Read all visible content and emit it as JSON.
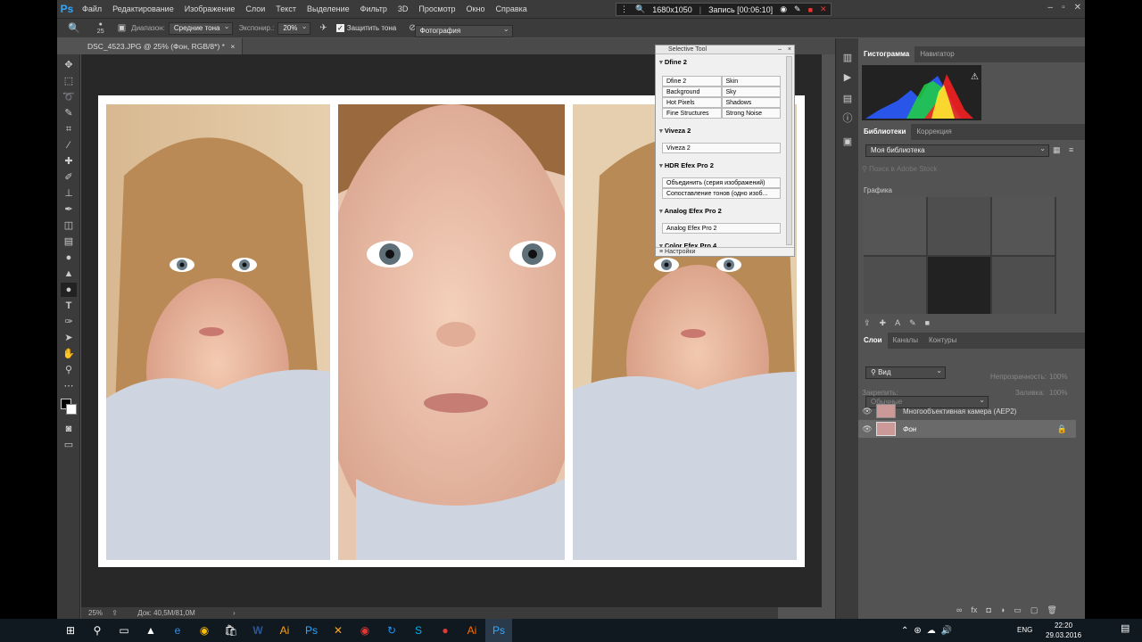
{
  "menubar": {
    "logo": "Ps",
    "items": [
      "Файл",
      "Редактирование",
      "Изображение",
      "Слои",
      "Текст",
      "Выделение",
      "Фильтр",
      "3D",
      "Просмотр",
      "Окно",
      "Справка"
    ],
    "rec_resolution": "1680x1050",
    "rec_label": "Запись [00:06:10]"
  },
  "options": {
    "brush_size": "25",
    "range_label": "Диапазон:",
    "range_value": "Средние тона",
    "exposure_label": "Экспонир.:",
    "exposure_value": "20%",
    "protect_label": "Защитить тона",
    "workspace": "Фотография"
  },
  "document": {
    "tab_title": "DSC_4523.JPG @ 25% (Фон, RGB/8*) *",
    "zoom": "25%",
    "doc_size": "Док: 40,5M/81,0M"
  },
  "selective_tool": {
    "title": "Selective Tool",
    "dfine_title": "Dfine 2",
    "dfine_items": [
      [
        "Dfine 2",
        "Skin"
      ],
      [
        "Background",
        "Sky"
      ],
      [
        "Hot Pixels",
        "Shadows"
      ],
      [
        "Fine Structures",
        "Strong Noise"
      ]
    ],
    "viveza_title": "Viveza 2",
    "viveza_item": "Viveza 2",
    "hdr_title": "HDR Efex Pro 2",
    "hdr_items": [
      "Объединить (серия изображений)",
      "Сопоставление тонов (одно изоб..."
    ],
    "analog_title": "Analog Efex Pro 2",
    "analog_item": "Analog Efex Pro 2",
    "color_title": "Color Efex Pro 4",
    "settings": "Настройки"
  },
  "panels": {
    "histogram_tab": "Гистограмма",
    "navigator_tab": "Навигатор",
    "libraries_tab": "Библиотеки",
    "adjust_tab": "Коррекция",
    "library_name": "Моя библиотека",
    "search_placeholder": "Поиск в Adobe Stock",
    "graphics_label": "Графика",
    "layers_tab": "Слои",
    "channels_tab": "Каналы",
    "paths_tab": "Контуры",
    "kind_filter": "Вид",
    "blend_mode": "Обычные",
    "opacity_label": "Непрозрачность:",
    "opacity_value": "100%",
    "lock_label": "Закрепить:",
    "fill_label": "Заливка:",
    "fill_value": "100%",
    "layers": [
      "Многообъективная камера (AEP2)",
      "Фон"
    ]
  },
  "taskbar": {
    "lang": "ENG",
    "time": "22:20",
    "date": "29.03.2016"
  }
}
